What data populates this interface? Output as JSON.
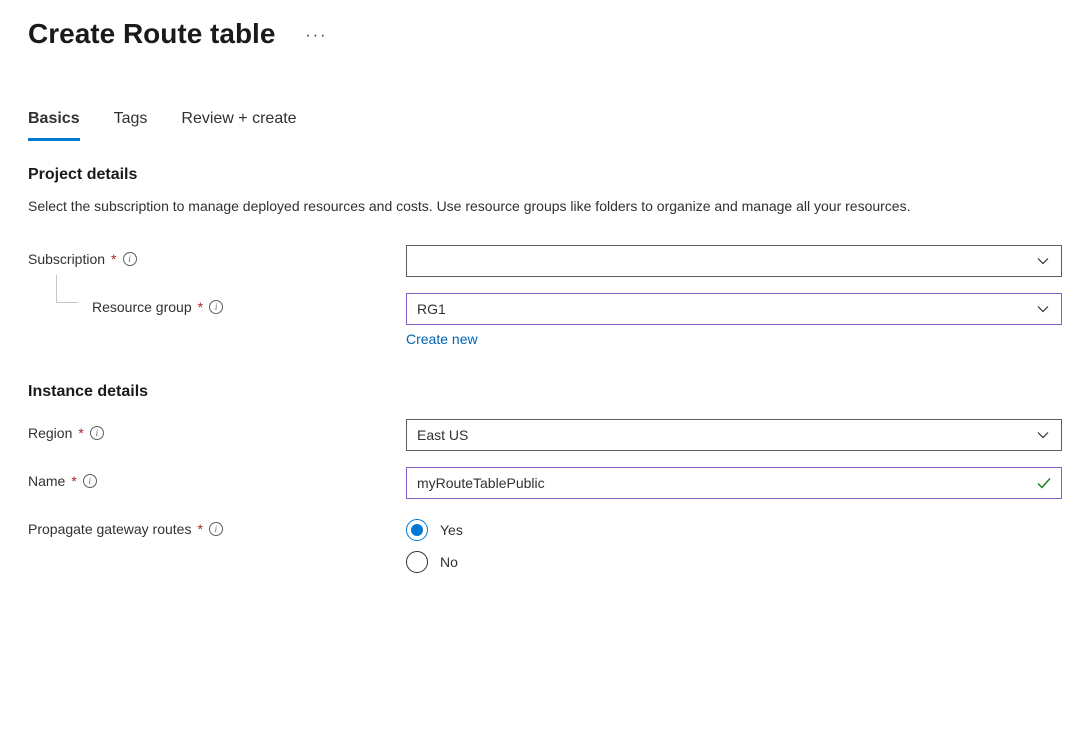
{
  "header": {
    "title": "Create Route table"
  },
  "tabs": {
    "items": [
      {
        "label": "Basics",
        "active": true
      },
      {
        "label": "Tags",
        "active": false
      },
      {
        "label": "Review + create",
        "active": false
      }
    ]
  },
  "sections": {
    "project": {
      "heading": "Project details",
      "description": "Select the subscription to manage deployed resources and costs. Use resource groups like folders to organize and manage all your resources.",
      "subscription": {
        "label": "Subscription",
        "value": ""
      },
      "resource_group": {
        "label": "Resource group",
        "value": "RG1",
        "create_new": "Create new"
      }
    },
    "instance": {
      "heading": "Instance details",
      "region": {
        "label": "Region",
        "value": "East US"
      },
      "name": {
        "label": "Name",
        "value": "myRouteTablePublic"
      },
      "propagate": {
        "label": "Propagate gateway routes",
        "options": {
          "yes": "Yes",
          "no": "No"
        },
        "selected": "yes"
      }
    }
  }
}
